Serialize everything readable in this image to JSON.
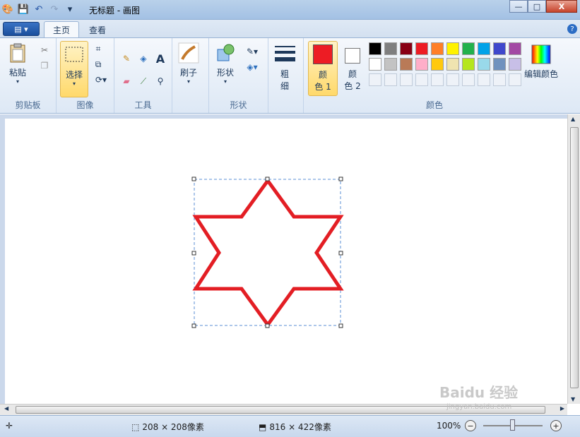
{
  "window": {
    "title": "无标题 - 画图",
    "min": "—",
    "max": "□",
    "close": "X"
  },
  "quick_access": {
    "app_icon": "paint-app-icon",
    "save_icon": "save-icon",
    "undo_icon": "undo-icon",
    "redo_icon": "redo-icon",
    "dropdown_icon": "dropdown-icon"
  },
  "tabs": {
    "file": "▤ ▾",
    "home": "主页",
    "view": "查看",
    "help": "?"
  },
  "ribbon": {
    "clipboard": {
      "label": "剪贴板",
      "paste": "粘贴"
    },
    "image": {
      "label": "图像",
      "select": "选择"
    },
    "tools": {
      "label": "工具"
    },
    "brushes": {
      "label": "刷子"
    },
    "shapes": {
      "label": "形状",
      "shapes_btn": "形状"
    },
    "size": {
      "label_a": "粗",
      "label_b": "细"
    },
    "colors": {
      "label": "颜色",
      "color1_a": "颜",
      "color1_b": "色 1",
      "color2_a": "颜",
      "color2_b": "色 2",
      "edit": "编辑颜色",
      "color1_value": "#ed1c24",
      "color2_value": "#ffffff",
      "palette_row1": [
        "#000000",
        "#7f7f7f",
        "#880015",
        "#ed1c24",
        "#ff7f27",
        "#fff200",
        "#22b14c",
        "#00a2e8",
        "#3f48cc",
        "#a349a4"
      ],
      "palette_row2": [
        "#ffffff",
        "#c3c3c3",
        "#b97a57",
        "#ffaec9",
        "#ffc90e",
        "#efe4b0",
        "#b5e61d",
        "#99d9ea",
        "#7092be",
        "#c8bfe7"
      ]
    }
  },
  "canvas": {
    "stroke_color": "#e31e24"
  },
  "status": {
    "selection_size": "208 × 208像素",
    "canvas_size": "816 × 422像素",
    "zoom": "100%"
  },
  "watermark": {
    "main": "Baidu 经验",
    "sub": "jingyan.baidu.com"
  }
}
